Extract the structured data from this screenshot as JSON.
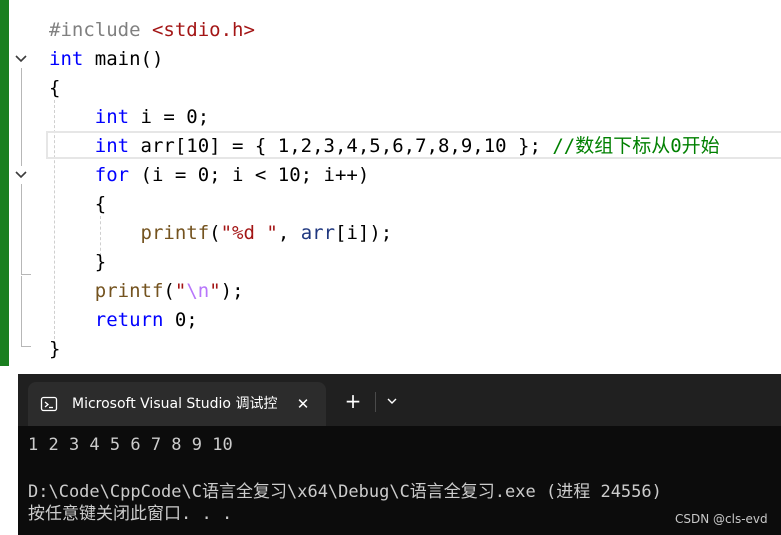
{
  "editor": {
    "lines": [
      {
        "tokens": [
          {
            "t": "#include ",
            "c": "pp"
          },
          {
            "t": "<stdio.h>",
            "c": "str"
          }
        ]
      },
      {
        "tokens": [
          {
            "t": "int",
            "c": "kw"
          },
          {
            "t": " main()",
            "c": ""
          }
        ]
      },
      {
        "tokens": [
          {
            "t": "{",
            "c": ""
          }
        ]
      },
      {
        "tokens": [
          {
            "t": "    ",
            "c": ""
          },
          {
            "t": "int",
            "c": "kw"
          },
          {
            "t": " i = 0;",
            "c": ""
          }
        ]
      },
      {
        "tokens": [
          {
            "t": "    ",
            "c": ""
          },
          {
            "t": "int",
            "c": "kw"
          },
          {
            "t": " arr[10] = { 1,2,3,4,5,6,7,8,9,10 }; ",
            "c": ""
          },
          {
            "t": "//数组下标从0开始",
            "c": "cmt"
          }
        ]
      },
      {
        "tokens": [
          {
            "t": "    ",
            "c": ""
          },
          {
            "t": "for",
            "c": "kw"
          },
          {
            "t": " (i = 0; i < 10; i++)",
            "c": ""
          }
        ]
      },
      {
        "tokens": [
          {
            "t": "    {",
            "c": ""
          }
        ]
      },
      {
        "tokens": [
          {
            "t": "        ",
            "c": ""
          },
          {
            "t": "printf",
            "c": "fn"
          },
          {
            "t": "(",
            "c": ""
          },
          {
            "t": "\"%d \"",
            "c": "str"
          },
          {
            "t": ", ",
            "c": ""
          },
          {
            "t": "arr",
            "c": "var"
          },
          {
            "t": "[i]);",
            "c": ""
          }
        ]
      },
      {
        "tokens": [
          {
            "t": "    }",
            "c": ""
          }
        ]
      },
      {
        "tokens": [
          {
            "t": "    ",
            "c": ""
          },
          {
            "t": "printf",
            "c": "fn"
          },
          {
            "t": "(",
            "c": ""
          },
          {
            "t": "\"",
            "c": "str"
          },
          {
            "t": "\\n",
            "c": "esc"
          },
          {
            "t": "\"",
            "c": "str"
          },
          {
            "t": ");",
            "c": ""
          }
        ]
      },
      {
        "tokens": [
          {
            "t": "    ",
            "c": ""
          },
          {
            "t": "return",
            "c": "kw"
          },
          {
            "t": " 0;",
            "c": ""
          }
        ]
      },
      {
        "tokens": [
          {
            "t": "}",
            "c": ""
          }
        ]
      }
    ]
  },
  "console": {
    "tab_title": "Microsoft Visual Studio 调试控制台",
    "close_glyph": "✕",
    "new_tab_glyph": "+",
    "output_line_1": "1 2 3 4 5 6 7 8 9 10",
    "output_line_2": "D:\\Code\\CppCode\\C语言全复习\\x64\\Debug\\C语言全复习.exe (进程 24556)",
    "output_line_3": "按任意键关闭此窗口. . ."
  },
  "watermark": "CSDN @cls-evd",
  "colors": {
    "change_bar": "#1a7f1f",
    "console_bg": "#0c0c0c",
    "keyword": "#0000ff",
    "comment": "#008000"
  }
}
